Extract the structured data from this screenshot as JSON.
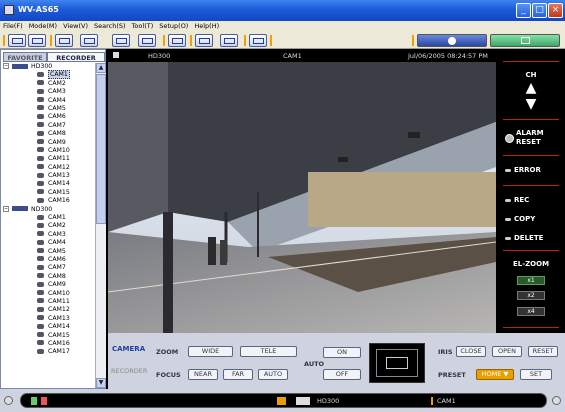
{
  "window": {
    "title": "WV-AS65",
    "controls": [
      "_",
      "□",
      "×"
    ]
  },
  "menu": [
    "File(F)",
    "Mode(M)",
    "View(V)",
    "Search(S)",
    "Tool(T)",
    "Setup(O)",
    "Help(H)"
  ],
  "tabs": {
    "favorite": "FAVORITE",
    "recorder": "RECORDER"
  },
  "tree": {
    "devices": [
      {
        "name": "HD300",
        "cameras": [
          "CAM1",
          "CAM2",
          "CAM3",
          "CAM4",
          "CAM5",
          "CAM6",
          "CAM7",
          "CAM8",
          "CAM9",
          "CAM10",
          "CAM11",
          "CAM12",
          "CAM13",
          "CAM14",
          "CAM15",
          "CAM16"
        ],
        "selected": "CAM1"
      },
      {
        "name": "ND300",
        "cameras": [
          "CAM1",
          "CAM2",
          "CAM3",
          "CAM4",
          "CAM5",
          "CAM6",
          "CAM7",
          "CAM8",
          "CAM9",
          "CAM10",
          "CAM11",
          "CAM12",
          "CAM13",
          "CAM14",
          "CAM15",
          "CAM16",
          "CAM17"
        ]
      }
    ]
  },
  "video": {
    "device": "HD300",
    "camera": "CAM1",
    "timestamp": "Jul/06/2005 08:24:57 PM"
  },
  "right_panel": {
    "ch": "CH",
    "alarm_reset": "ALARM RESET",
    "error": "ERROR",
    "rec": "REC",
    "copy": "COPY",
    "delete": "DELETE",
    "el_zoom": "EL-ZOOM",
    "zoom_levels": [
      "x1",
      "x2",
      "x4"
    ]
  },
  "controls": {
    "camera_tab": "CAMERA",
    "recorder_tab": "RECORDER",
    "zoom": "ZOOM",
    "wide": "WIDE",
    "tele": "TELE",
    "focus": "FOCUS",
    "near": "NEAR",
    "far": "FAR",
    "auto": "AUTO",
    "auto_label": "AUTO",
    "on": "ON",
    "off": "OFF",
    "iris": "IRIS",
    "close": "CLOSE",
    "open": "OPEN",
    "reset": "RESET",
    "preset": "PRESET",
    "home": "HOME",
    "set": "SET"
  },
  "status": {
    "device": "HD300",
    "camera": "CAM1"
  },
  "colors": {
    "title_bar": "#1c5bd8",
    "panel_bg": "#cfd3df",
    "accent_orange": "#e8a000",
    "alert_red": "#b22222"
  }
}
